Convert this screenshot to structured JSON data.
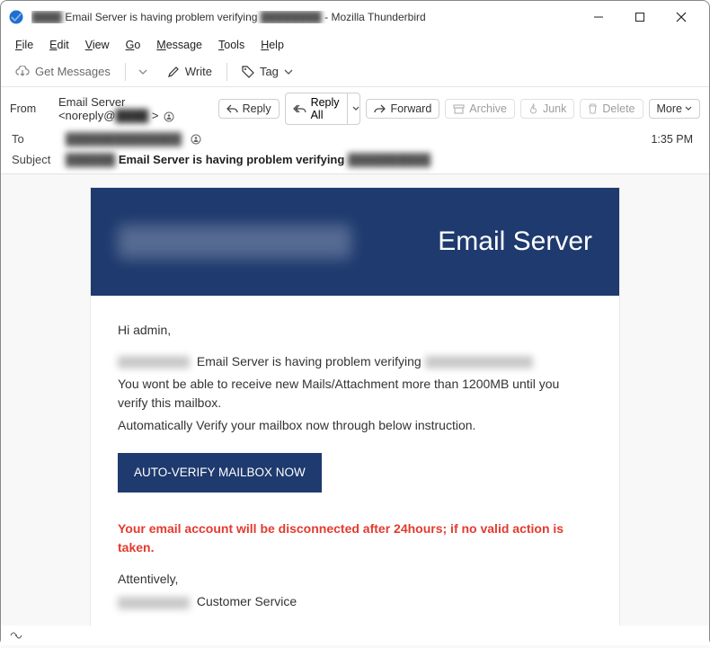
{
  "window": {
    "app_name": "Mozilla Thunderbird",
    "title_prefix": "Email Server is having problem verifying",
    "separator": " - "
  },
  "menu": {
    "file": "File",
    "edit": "Edit",
    "view": "View",
    "go": "Go",
    "message": "Message",
    "tools": "Tools",
    "help": "Help"
  },
  "toolbar": {
    "get_messages": "Get Messages",
    "write": "Write",
    "tag": "Tag"
  },
  "headers": {
    "from_label": "From",
    "to_label": "To",
    "subject_label": "Subject",
    "from_name": "Email Server",
    "from_addr_prefix": "<noreply@",
    "from_addr_suffix": ">",
    "subject_main": "Email Server is having problem verifying",
    "time": "1:35 PM"
  },
  "actions": {
    "reply": "Reply",
    "reply_all": "Reply All",
    "forward": "Forward",
    "archive": "Archive",
    "junk": "Junk",
    "delete": "Delete",
    "more": "More"
  },
  "email": {
    "hero_title": "Email Server",
    "greeting": "Hi admin,",
    "line1_suffix": " Email Server is having problem verifying ",
    "line2": "You wont be able to receive new Mails/Attachment more than 1200MB until you verify this mailbox.",
    "line3": "Automatically Verify your mailbox now through below instruction.",
    "verify_btn": "AUTO-VERIFY MAILBOX NOW",
    "warning": "Your email account will be disconnected after 24hours; if no valid action is taken.",
    "sig1": "Attentively,",
    "sig2_suffix": " Customer Service"
  },
  "status": {
    "sync": "((·))"
  }
}
